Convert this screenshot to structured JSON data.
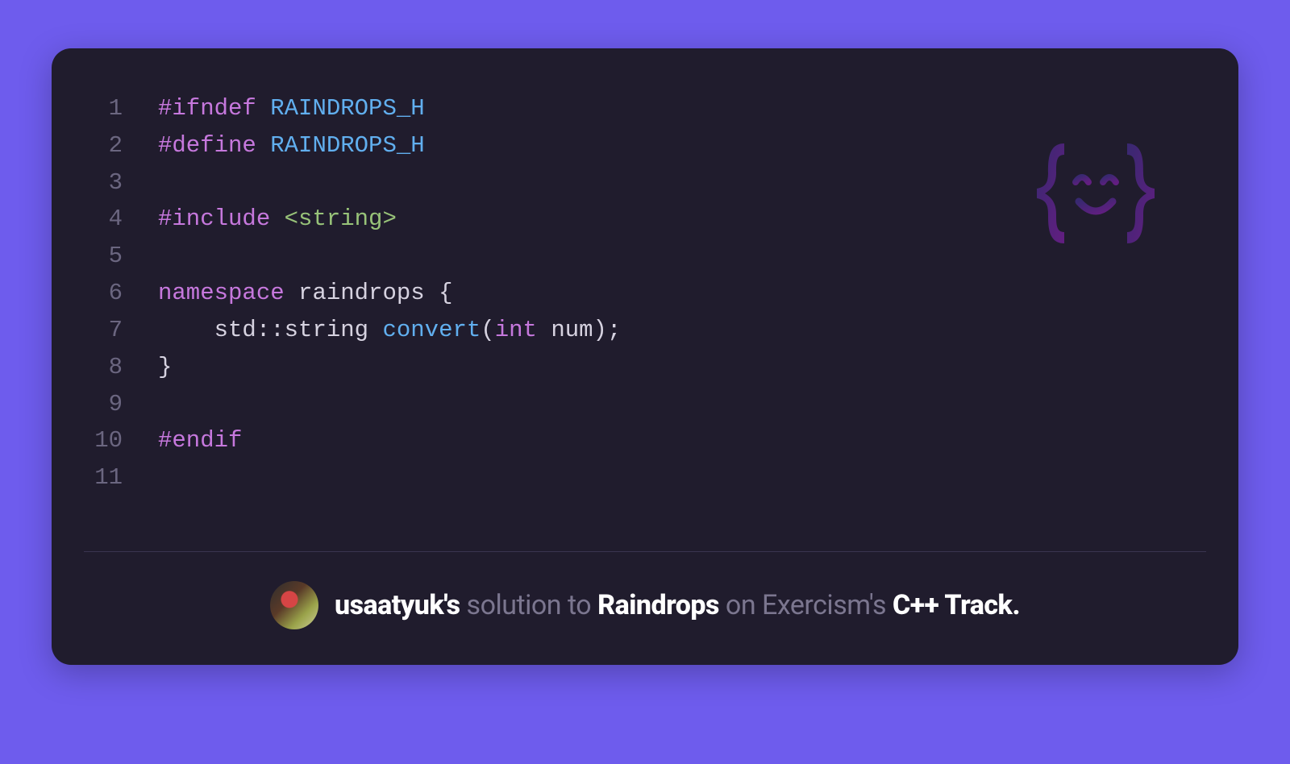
{
  "code": {
    "lines": [
      [
        {
          "cls": "tk-directive",
          "t": "#ifndef"
        },
        {
          "cls": "tk-ident",
          "t": " "
        },
        {
          "cls": "tk-macro",
          "t": "RAINDROPS_H"
        }
      ],
      [
        {
          "cls": "tk-directive",
          "t": "#define"
        },
        {
          "cls": "tk-ident",
          "t": " "
        },
        {
          "cls": "tk-macro",
          "t": "RAINDROPS_H"
        }
      ],
      [],
      [
        {
          "cls": "tk-directive",
          "t": "#include"
        },
        {
          "cls": "tk-ident",
          "t": " "
        },
        {
          "cls": "tk-string-angle",
          "t": "<string>"
        }
      ],
      [],
      [
        {
          "cls": "tk-keyword",
          "t": "namespace"
        },
        {
          "cls": "tk-ident",
          "t": " raindrops "
        },
        {
          "cls": "tk-punct",
          "t": "{"
        }
      ],
      [
        {
          "cls": "tk-ident",
          "t": "    std"
        },
        {
          "cls": "tk-punct",
          "t": "::"
        },
        {
          "cls": "tk-ident",
          "t": "string "
        },
        {
          "cls": "tk-func",
          "t": "convert"
        },
        {
          "cls": "tk-punct",
          "t": "("
        },
        {
          "cls": "tk-type",
          "t": "int"
        },
        {
          "cls": "tk-ident",
          "t": " num"
        },
        {
          "cls": "tk-punct",
          "t": ");"
        }
      ],
      [
        {
          "cls": "tk-punct",
          "t": "}"
        }
      ],
      [],
      [
        {
          "cls": "tk-directive",
          "t": "#endif"
        }
      ],
      []
    ]
  },
  "footer": {
    "user": "usaatyuk's",
    "mid1": " solution to ",
    "exercise": "Raindrops",
    "mid2": " on Exercism's ",
    "track": "C++ Track."
  }
}
